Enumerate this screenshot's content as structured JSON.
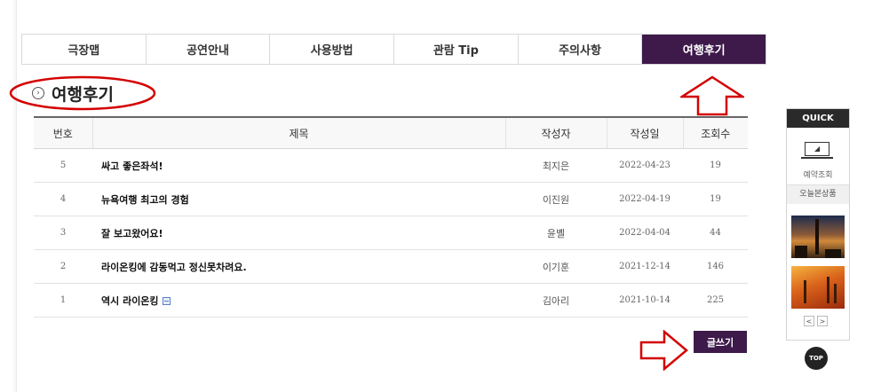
{
  "tabs": [
    {
      "label": "극장맵",
      "active": false
    },
    {
      "label": "공연안내",
      "active": false
    },
    {
      "label": "사용방법",
      "active": false
    },
    {
      "label": "관람 Tip",
      "active": false
    },
    {
      "label": "주의사항",
      "active": false
    },
    {
      "label": "여행후기",
      "active": true
    }
  ],
  "section": {
    "title": "여행후기",
    "icon": "chevron-circle-icon"
  },
  "board": {
    "headers": {
      "no": "번호",
      "subject": "제목",
      "writer": "작성자",
      "date": "작성일",
      "views": "조회수"
    },
    "rows": [
      {
        "no": "5",
        "subject": "싸고 좋은좌석!",
        "writer": "최지은",
        "date": "2022-04-23",
        "views": "19",
        "attachment": false
      },
      {
        "no": "4",
        "subject": "뉴욕여행 최고의 경험",
        "writer": "이진원",
        "date": "2022-04-19",
        "views": "19",
        "attachment": false
      },
      {
        "no": "3",
        "subject": "잘 보고왔어요!",
        "writer": "윤볠",
        "date": "2022-04-04",
        "views": "44",
        "attachment": false
      },
      {
        "no": "2",
        "subject": "라이온킹에 감동먹고 정신못차려요.",
        "writer": "이기훈",
        "date": "2021-12-14",
        "views": "146",
        "attachment": false
      },
      {
        "no": "1",
        "subject": "역시 라이온킹",
        "writer": "김아리",
        "date": "2021-10-14",
        "views": "225",
        "attachment": true
      }
    ]
  },
  "write_button": {
    "label": "글쓰기"
  },
  "quick": {
    "title": "QUICK",
    "reserve_label": "예약조회",
    "today_label": "오늘본상품",
    "prev": "<",
    "next": ">"
  },
  "top_button": {
    "label": "TOP"
  },
  "colors": {
    "accent": "#3d1a4a",
    "annotation": "#d40000"
  }
}
